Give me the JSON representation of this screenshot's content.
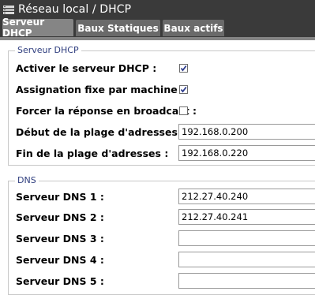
{
  "window": {
    "title": "Réseau local / DHCP",
    "icon": "network-router-icon"
  },
  "tabs": [
    {
      "label": "Serveur DHCP",
      "active": true
    },
    {
      "label": "Baux Statiques",
      "active": false
    },
    {
      "label": "Baux actifs",
      "active": false
    }
  ],
  "dhcp": {
    "legend": "Serveur DHCP",
    "enable_label": "Activer le serveur DHCP :",
    "enable_checked": true,
    "fixed_label": "Assignation fixe par machine :",
    "fixed_checked": true,
    "broadcast_label": "Forcer la réponse en broadcast :",
    "broadcast_checked": false,
    "start_label": "Début de la plage d'adresses :",
    "start_value": "192.168.0.200",
    "end_label": "Fin de la plage d'adresses :",
    "end_value": "192.168.0.220"
  },
  "dns": {
    "legend": "DNS",
    "servers": [
      {
        "label": "Serveur DNS 1 :",
        "value": "212.27.40.240"
      },
      {
        "label": "Serveur DNS 2 :",
        "value": "212.27.40.241"
      },
      {
        "label": "Serveur DNS 3 :",
        "value": ""
      },
      {
        "label": "Serveur DNS 4 :",
        "value": ""
      },
      {
        "label": "Serveur DNS 5 :",
        "value": ""
      }
    ]
  },
  "colors": {
    "header_bg": "#3a3a3a",
    "tab_bg": "#6a6a6a",
    "tab_active_bg": "#858585",
    "legend_color": "#2e3d7e"
  }
}
